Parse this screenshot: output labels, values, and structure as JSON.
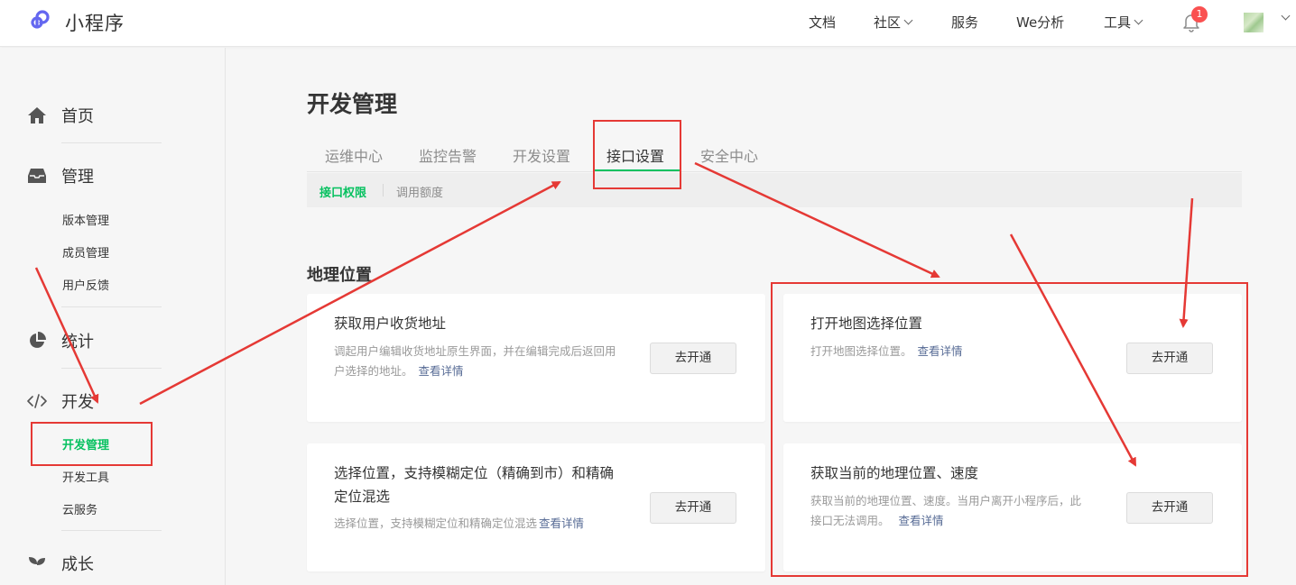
{
  "header": {
    "app_name": "小程序",
    "nav": [
      "文档",
      "社区",
      "服务",
      "We分析",
      "工具"
    ],
    "notification_count": "1"
  },
  "sidebar": {
    "groups": [
      {
        "label": "首页",
        "icon": "home-icon"
      },
      {
        "label": "管理",
        "icon": "inbox-icon",
        "items": [
          "版本管理",
          "成员管理",
          "用户反馈"
        ]
      },
      {
        "label": "统计",
        "icon": "pie-chart-icon"
      },
      {
        "label": "开发",
        "icon": "code-icon",
        "items": [
          "开发管理",
          "开发工具",
          "云服务"
        ],
        "active_item": "开发管理"
      },
      {
        "label": "成长",
        "icon": "sprout-icon"
      }
    ]
  },
  "main": {
    "title": "开发管理",
    "tabs": [
      "运维中心",
      "监控告警",
      "开发设置",
      "接口设置",
      "安全中心"
    ],
    "active_tab": "接口设置",
    "subtabs": [
      "接口权限",
      "调用额度"
    ],
    "section_title": "地理位置",
    "link_text": "查看详情",
    "button_label": "去开通",
    "cards": [
      {
        "title": "获取用户收货地址",
        "desc": "调起用户编辑收货地址原生界面，并在编辑完成后返回用户选择的地址。"
      },
      {
        "title": "打开地图选择位置",
        "desc": "打开地图选择位置。"
      },
      {
        "title": "选择位置，支持模糊定位（精确到市）和精确定位混选",
        "desc": "选择位置，支持模糊定位和精确定位混选"
      },
      {
        "title": "获取当前的地理位置、速度",
        "desc": "获取当前的地理位置、速度。当用户离开小程序后，此接口无法调用。"
      }
    ]
  },
  "colors": {
    "accent_green": "#07c160",
    "link_blue": "#576b95",
    "annotation_red": "#e53935"
  }
}
